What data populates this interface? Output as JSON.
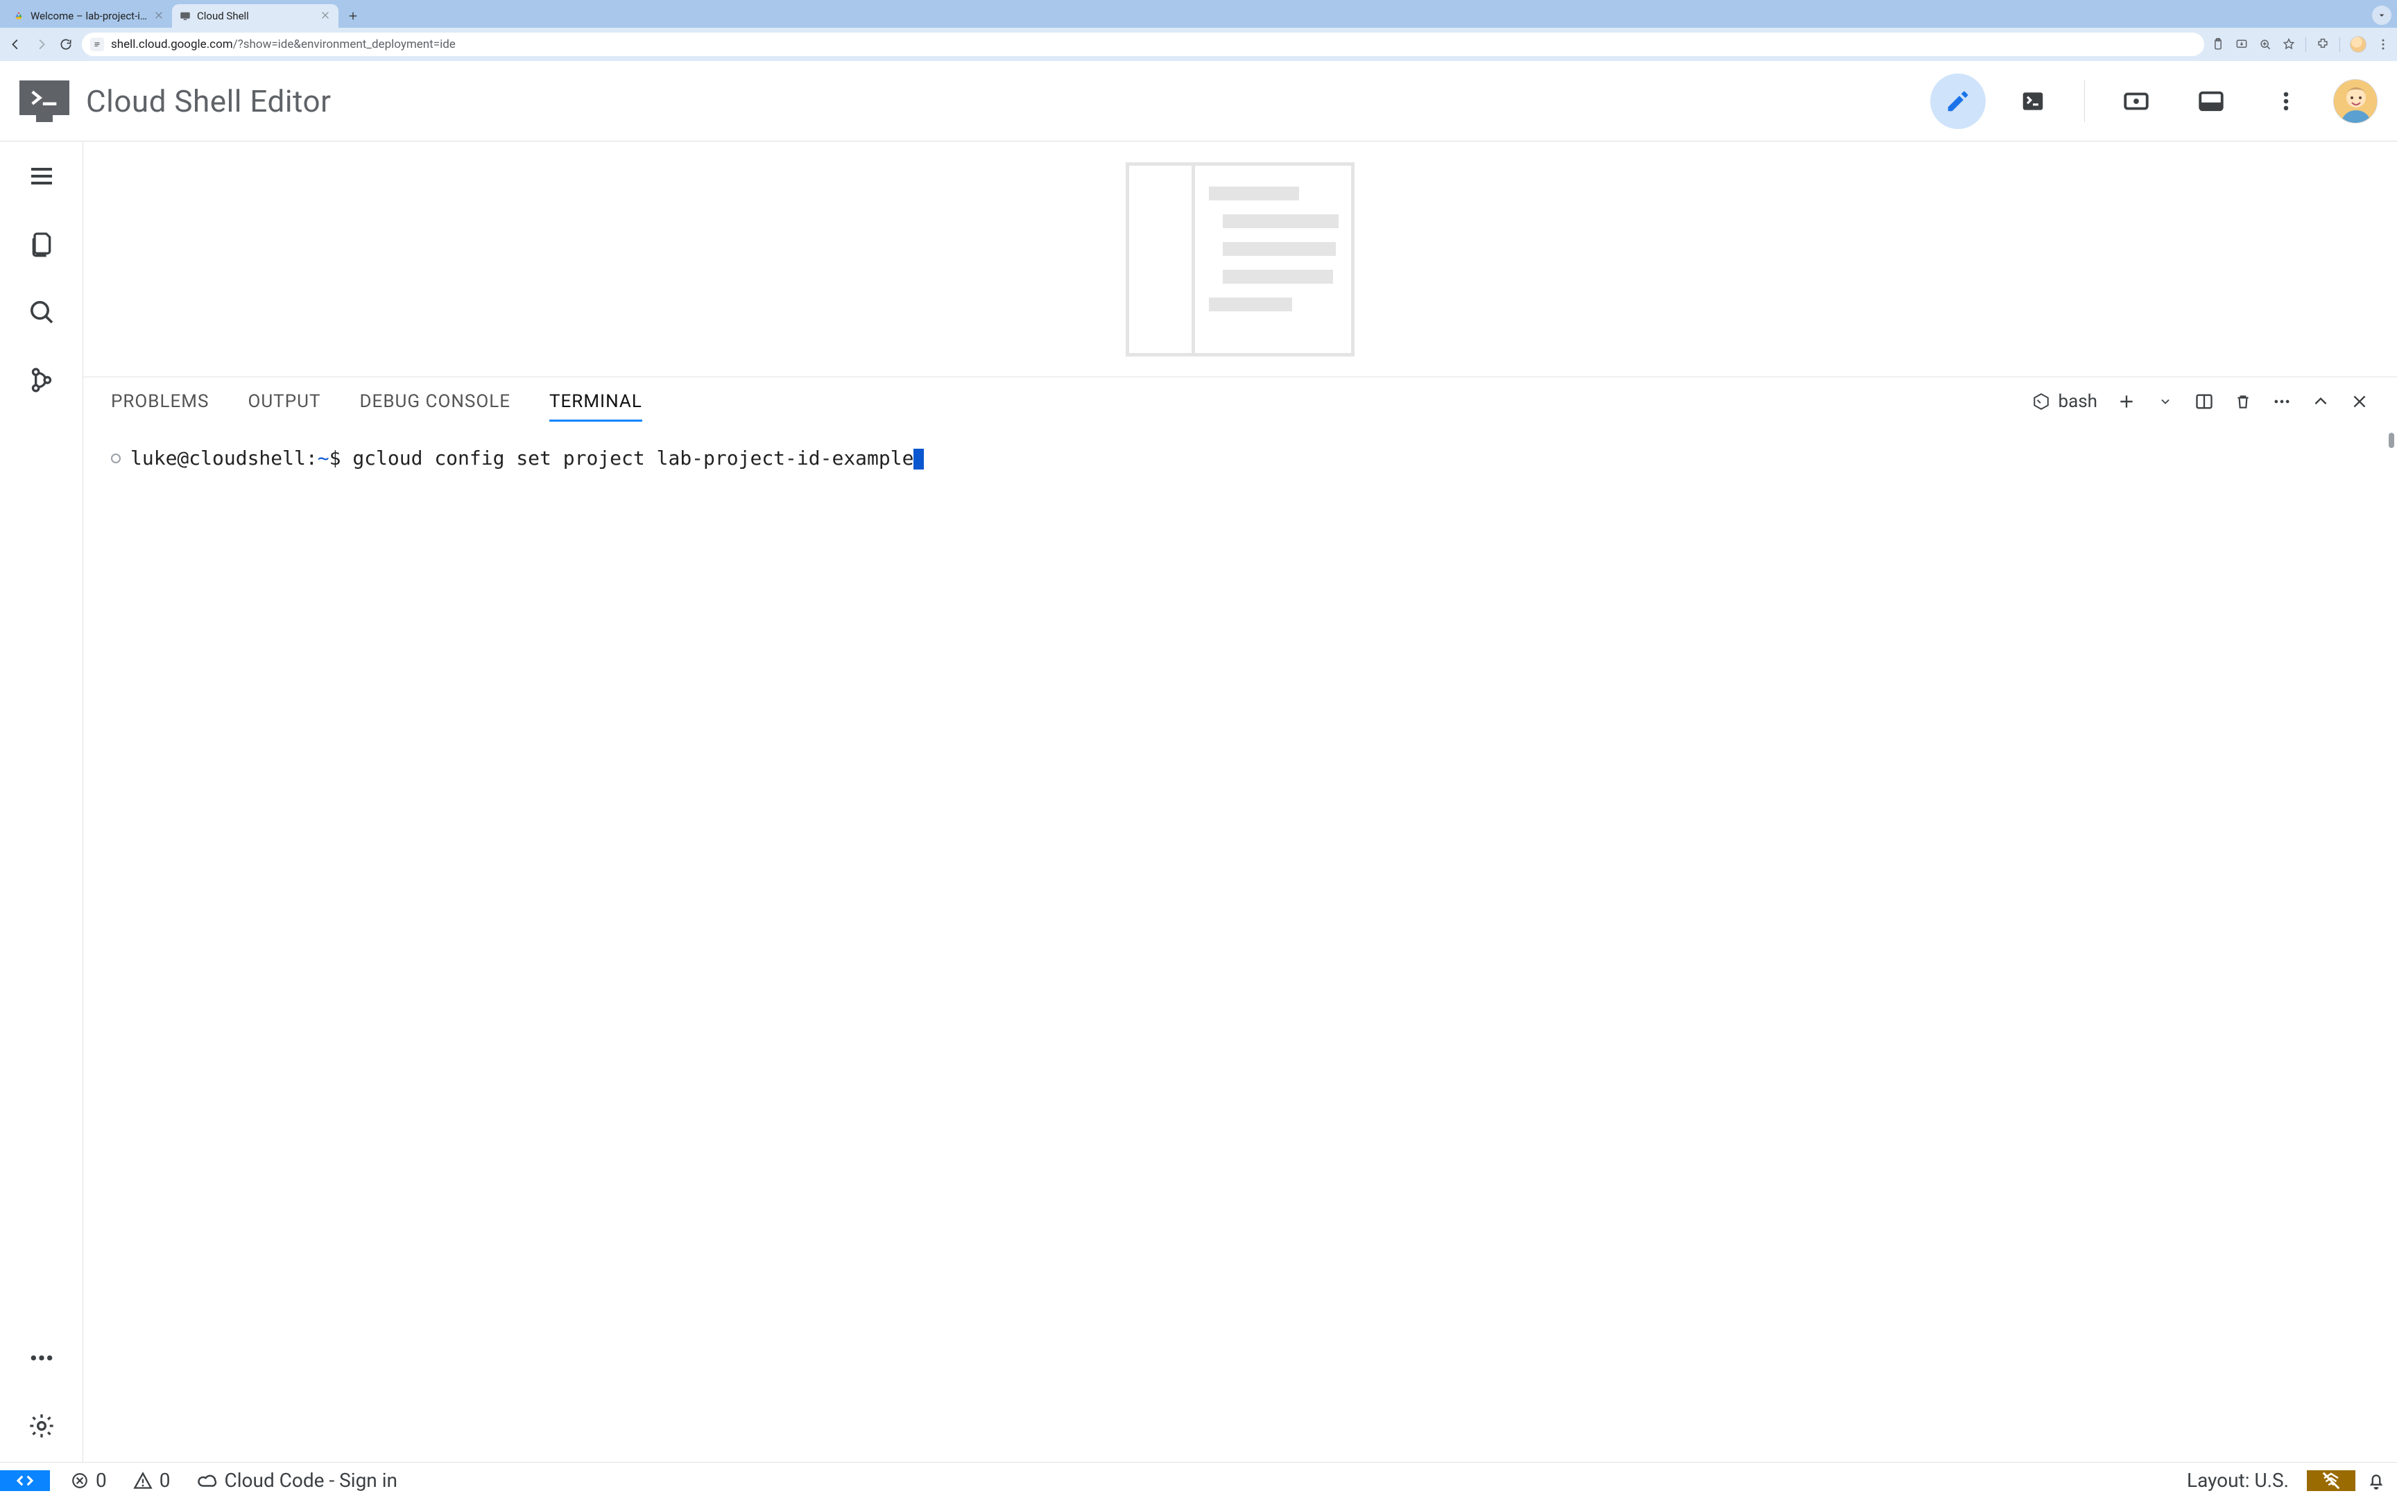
{
  "browser": {
    "tabs": [
      {
        "title": "Welcome – lab-project-id-ex",
        "active": false
      },
      {
        "title": "Cloud Shell",
        "active": true
      }
    ],
    "url_host": "shell.cloud.google.com",
    "url_rest": "/?show=ide&environment_deployment=ide"
  },
  "header": {
    "title": "Cloud Shell Editor"
  },
  "panel": {
    "tabs": {
      "problems": "PROBLEMS",
      "output": "OUTPUT",
      "debug": "DEBUG CONSOLE",
      "terminal": "TERMINAL"
    },
    "shell_name": "bash"
  },
  "terminal": {
    "prompt_user": "luke@cloudshell",
    "prompt_sep": ":",
    "prompt_path": "~",
    "prompt_dollar": "$",
    "command": "gcloud config set project lab-project-id-example"
  },
  "status": {
    "errors": "0",
    "warnings": "0",
    "cloudcode": "Cloud Code - Sign in",
    "layout": "Layout: U.S."
  }
}
